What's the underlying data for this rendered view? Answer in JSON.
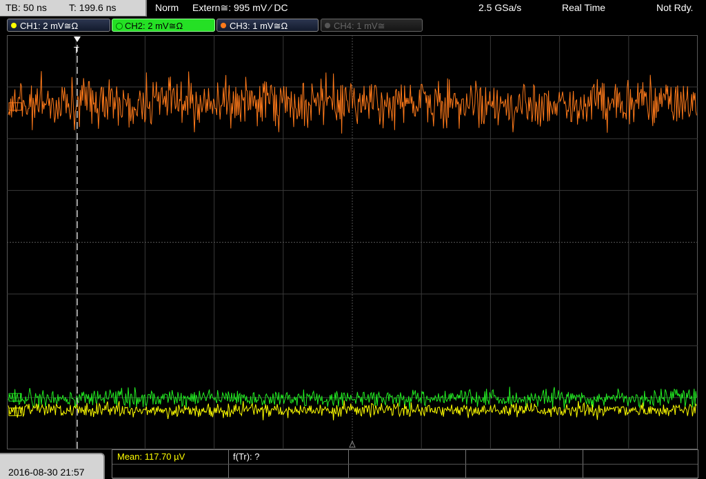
{
  "status": {
    "timebase": "TB: 50 ns",
    "trigger_time": "T: 199.6 ns",
    "trigger_mode": "Norm",
    "trigger_source": "Extern≅: 995 mV ⁄ DC",
    "sample_rate": "2.5 GSa/s",
    "acq_mode": "Real Time",
    "run_state": "Not Rdy."
  },
  "channels": [
    {
      "label": "CH1: 2 mV≅Ω",
      "color": "#ffff00",
      "state": "on"
    },
    {
      "label": "CH2: 2 mV≅Ω",
      "color": "#22ee22",
      "state": "active"
    },
    {
      "label": "CH3: 1 mV≅Ω",
      "color": "#ff7a1a",
      "state": "on"
    },
    {
      "label": "CH4: 1 mV≅",
      "color": "#555555",
      "state": "off"
    }
  ],
  "screen": {
    "trigger_marker": "T",
    "traces": [
      {
        "channel": "CH3",
        "color": "#ff7a1a"
      },
      {
        "channel": "CH2",
        "color": "#22ee22"
      },
      {
        "channel": "CH1",
        "color": "#ffff00"
      }
    ]
  },
  "footer": {
    "datetime": "2016-08-30 21:57",
    "measurements": [
      {
        "label": "Mean: 117.70 µV",
        "color": "#ffff00"
      },
      {
        "label": "f(Tr): ?",
        "color": "#ffffff"
      }
    ]
  }
}
